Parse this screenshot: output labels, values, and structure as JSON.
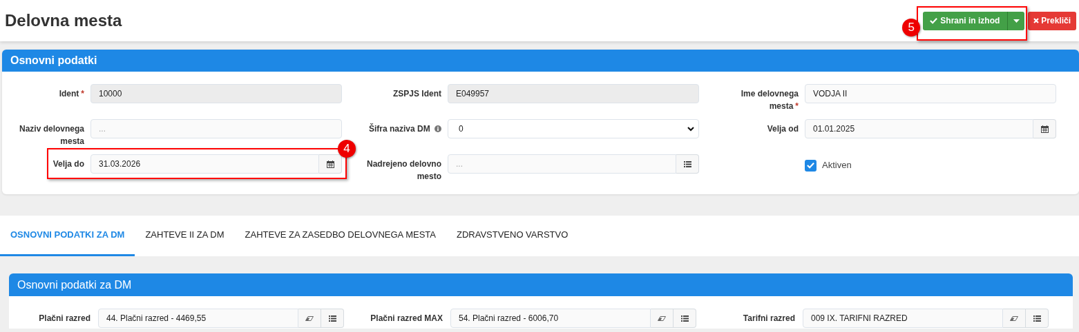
{
  "page": {
    "title": "Delovna mesta"
  },
  "toolbar": {
    "callout": "5",
    "buttons": [
      {
        "kind": "save",
        "label": "Shrani in izhod"
      },
      {
        "kind": "cancel",
        "label": "Prekliči"
      }
    ]
  },
  "section": {
    "title": "Osnovni podatki",
    "fields": [
      {
        "kind": "text",
        "label": "Ident",
        "required_mark": "*",
        "value": "10000",
        "readonly": true
      },
      {
        "kind": "text",
        "label": "ZSPJS Ident",
        "value": "E049957",
        "readonly": true
      },
      {
        "kind": "text",
        "label": "Ime delovnega mesta",
        "required_mark": "*",
        "value": "VODJA II",
        "readonly": false
      },
      {
        "kind": "text",
        "label": "Naziv delovnega mesta",
        "placeholder": "...",
        "readonly": false
      },
      {
        "kind": "select",
        "label": "Šifra naziva DM",
        "info": true,
        "value": "0"
      },
      {
        "kind": "date",
        "label": "Velja od",
        "value": "01.01.2025"
      },
      {
        "kind": "date",
        "label": "Velja do",
        "value": "31.03.2026",
        "callout": "4"
      },
      {
        "kind": "lookup",
        "label": "Nadrejeno delovno mesto",
        "placeholder": "..."
      },
      {
        "kind": "checkbox",
        "label": "Aktiven",
        "checked": true
      }
    ]
  },
  "tabs": [
    {
      "label": "OSNOVNI PODATKI ZA DM",
      "selected": true
    },
    {
      "label": "ZAHTEVE II ZA DM",
      "selected": false
    },
    {
      "label": "ZAHTEVE ZA ZASEDBO DELOVNEGA MESTA",
      "selected": false
    },
    {
      "label": "ZDRAVSTVENO VARSTVO",
      "selected": false
    }
  ],
  "sub_section": {
    "title": "Osnovni podatki za DM",
    "fields": [
      {
        "label": "Plačni razred",
        "value": "44. Plačni razred - 4469,55"
      },
      {
        "label": "Plačni razred MAX",
        "value": "54. Plačni razred - 6006,70"
      },
      {
        "label": "Tarifni razred",
        "value": "009 IX. TARIFNI RAZRED"
      }
    ]
  }
}
